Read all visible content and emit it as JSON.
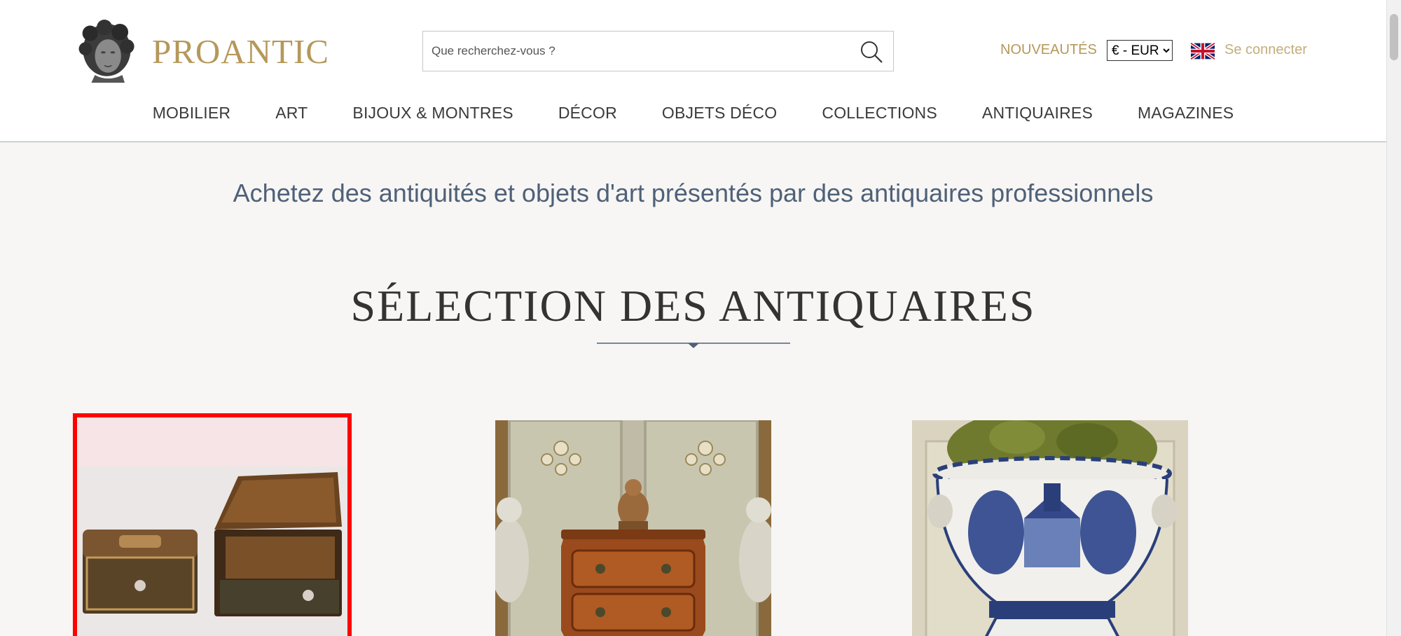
{
  "header": {
    "logo_text": "PROANTIC",
    "search_placeholder": "Que recherchez-vous ?",
    "new_label": "NOUVEAUTÉS",
    "currency": {
      "selected": "€ - EUR",
      "options": [
        "€ - EUR"
      ]
    },
    "login_label": "Se connecter",
    "language_icon": "uk-flag-icon"
  },
  "nav": {
    "items": [
      {
        "label": "MOBILIER"
      },
      {
        "label": "ART"
      },
      {
        "label": "BIJOUX & MONTRES"
      },
      {
        "label": "DÉCOR"
      },
      {
        "label": "OBJETS DÉCO"
      },
      {
        "label": "COLLECTIONS"
      },
      {
        "label": "ANTIQUAIRES"
      },
      {
        "label": "MAGAZINES"
      }
    ]
  },
  "main": {
    "tagline": "Achetez des antiquités et objets d'art présentés par des antiquaires professionnels",
    "section_title": "SÉLECTION DES ANTIQUAIRES"
  },
  "colors": {
    "brand_gold": "#b5985a",
    "text_blue": "#4f6178",
    "highlight": "#ff0000",
    "background": "#f7f6f4"
  }
}
